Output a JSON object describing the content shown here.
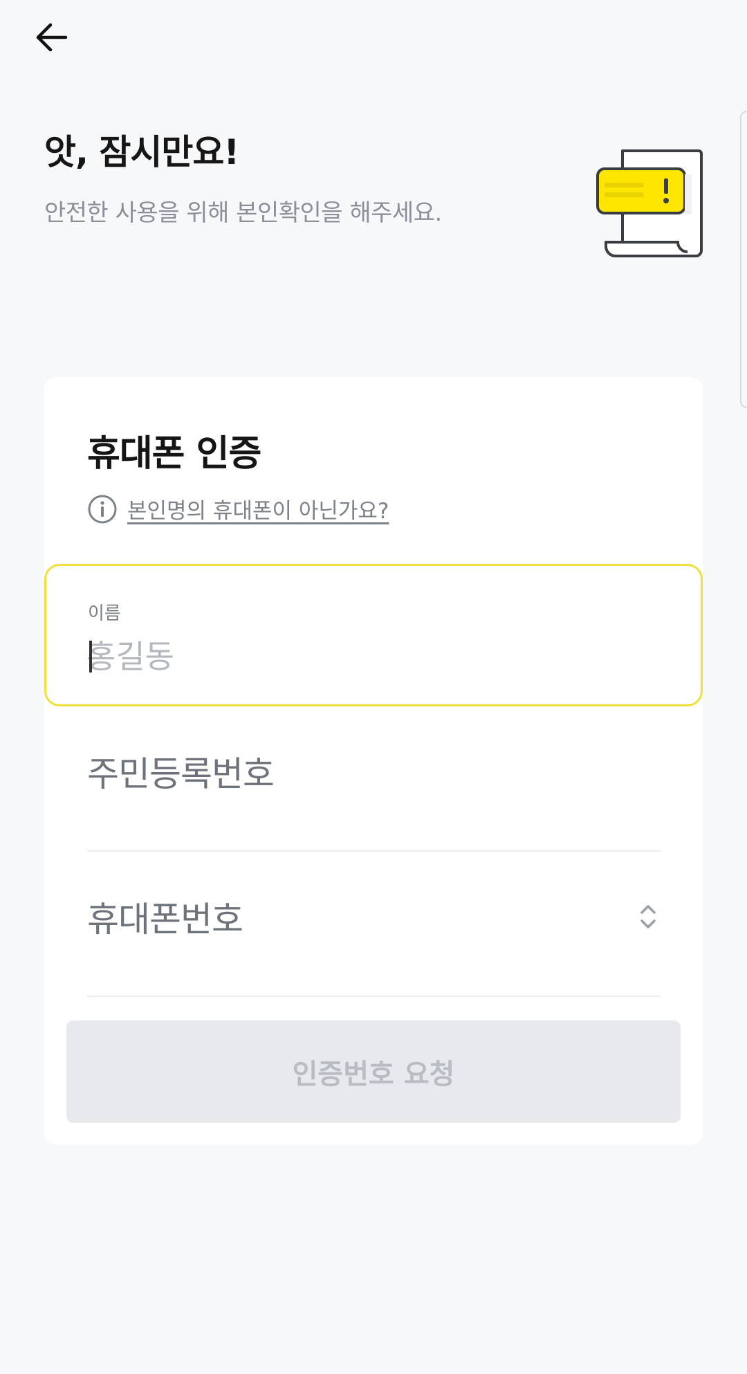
{
  "header": {
    "title": "앗, 잠시만요!",
    "subtitle": "안전한 사용을 위해 본인확인을 해주세요."
  },
  "card": {
    "title": "휴대폰 인증",
    "info_link": "본인명의 휴대폰이 아닌가요?",
    "name_field": {
      "label": "이름",
      "placeholder": "홍길동",
      "value": ""
    },
    "ssn_field": {
      "label": "주민등록번호"
    },
    "phone_field": {
      "label": "휴대폰번호"
    },
    "request_button": "인증번호 요청"
  },
  "colors": {
    "accent_yellow": "#f2e03a",
    "background": "#f7f8fa",
    "button_disabled": "#e7e9ed"
  },
  "icons": [
    "back-arrow-icon",
    "info-icon",
    "up-down-chevron-icon",
    "document-alert-illustration"
  ]
}
